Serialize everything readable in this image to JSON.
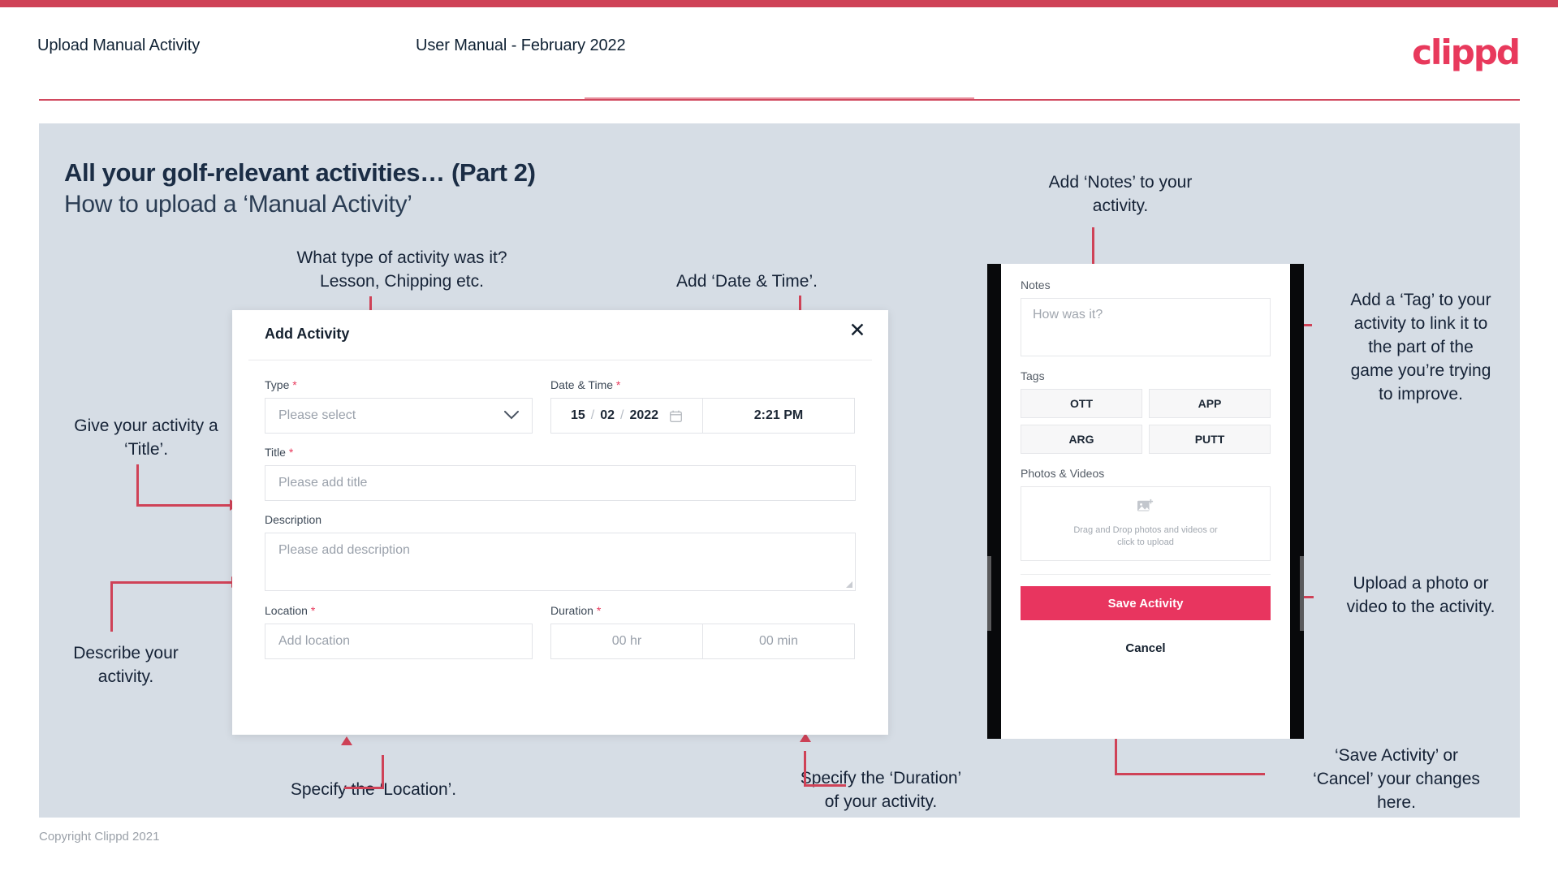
{
  "header": {
    "title": "Upload Manual Activity",
    "subtitle": "User Manual - February 2022",
    "logo": "clippd"
  },
  "slide": {
    "heading": "All your golf-relevant activities… (Part 2)",
    "subheading": "How to upload a ‘Manual Activity’"
  },
  "annotations": {
    "type": "What type of activity was it?\nLesson, Chipping etc.",
    "datetime": "Add ‘Date & Time’.",
    "title": "Give your activity a\n‘Title’.",
    "describe": "Describe your\nactivity.",
    "location": "Specify the ‘Location’.",
    "duration": "Specify the ‘Duration’\nof your activity.",
    "notes": "Add ‘Notes’ to your\nactivity.",
    "tag": "Add a ‘Tag’ to your\nactivity to link it to\nthe part of the\ngame you’re trying\nto improve.",
    "upload": "Upload a photo or\nvideo to the activity.",
    "save": "‘Save Activity’ or\n‘Cancel’ your changes\nhere."
  },
  "modal": {
    "title": "Add Activity",
    "close_icon": "close-icon",
    "fields": {
      "type": {
        "label": "Type",
        "required": "*",
        "placeholder": "Please select",
        "chevron": "chevron-down-icon"
      },
      "datetime": {
        "label": "Date & Time",
        "required": "*",
        "day": "15",
        "month": "02",
        "year": "2022",
        "sep": "/",
        "calendar_icon": "calendar-icon",
        "time": "2:21 PM"
      },
      "title": {
        "label": "Title",
        "required": "*",
        "placeholder": "Please add title"
      },
      "description": {
        "label": "Description",
        "required": "",
        "placeholder": "Please add description"
      },
      "location": {
        "label": "Location",
        "required": "*",
        "placeholder": "Add location"
      },
      "duration": {
        "label": "Duration",
        "required": "*",
        "hours": "00 hr",
        "minutes": "00 min"
      }
    }
  },
  "phone": {
    "notes_label": "Notes",
    "notes_placeholder": "How was it?",
    "tags_label": "Tags",
    "tags": [
      "OTT",
      "APP",
      "ARG",
      "PUTT"
    ],
    "photos_label": "Photos & Videos",
    "drop_icon": "add-image-icon",
    "drop_text": "Drag and Drop photos and videos or\nclick to upload",
    "save_label": "Save Activity",
    "cancel_label": "Cancel"
  },
  "footer": {
    "copyright": "Copyright Clippd 2021"
  },
  "colors": {
    "accent": "#e8395c",
    "bar": "#cf4257",
    "slide_bg": "#d6dde5",
    "text": "#15212f"
  }
}
